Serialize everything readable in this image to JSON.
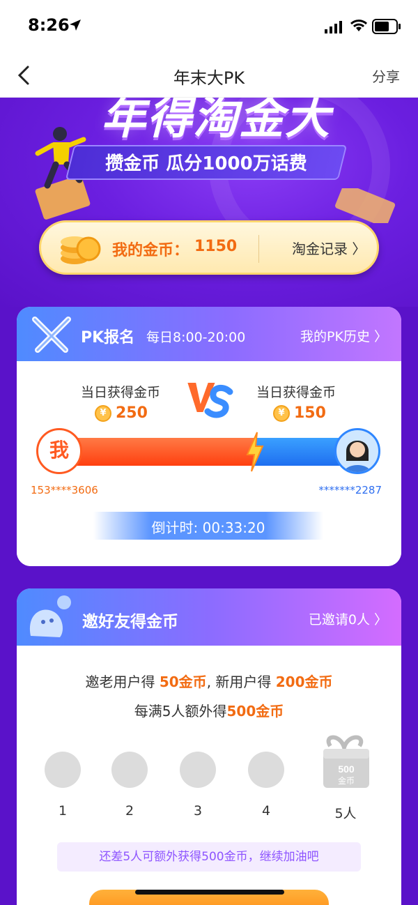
{
  "status": {
    "time": "8:26"
  },
  "nav": {
    "title": "年末大PK",
    "share": "分享"
  },
  "hero": {
    "big_title": "年得淘金大",
    "banner": "攒金币 瓜分1000万话费",
    "coins_label": "我的金币：",
    "coins_value": "1150",
    "record_link": "淘金记录 〉"
  },
  "pk": {
    "title": "PK报名",
    "time": "每日8:00-20:00",
    "history_link": "我的PK历史 〉",
    "left_label": "当日获得金币",
    "right_label": "当日获得金币",
    "left_score": "250",
    "right_score": "150",
    "yen_symbol": "¥",
    "me_label": "我",
    "left_phone": "153****3606",
    "right_phone": "*******2287",
    "countdown": "倒计时: 00:33:20",
    "left_share": 0.625
  },
  "invite": {
    "title": "邀好友得金币",
    "invited_link": "已邀请0人 〉",
    "line1_a": "邀老用户得 ",
    "line1_b": "50金币",
    "line1_c": ", 新用户得 ",
    "line1_d": "200金币",
    "line2_a": "每满5人额外得",
    "line2_b": "500金币",
    "slots": [
      "1",
      "2",
      "3",
      "4",
      "5人"
    ],
    "gift_text_top": "500",
    "gift_text_bottom": "金币",
    "tip": "还差5人可额外获得500金币，继续加油吧"
  },
  "colors": {
    "accent": "#f26b12",
    "purple": "#5a12c9",
    "blue": "#2f6ff0"
  }
}
